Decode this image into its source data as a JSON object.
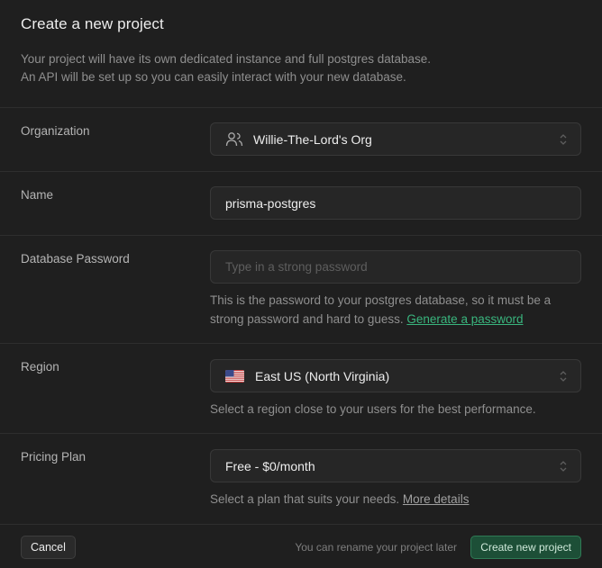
{
  "dialog": {
    "title": "Create a new project",
    "description_line1": "Your project will have its own dedicated instance and full postgres database.",
    "description_line2": "An API will be set up so you can easily interact with your new database."
  },
  "organization": {
    "label": "Organization",
    "value": "Willie-The-Lord's Org",
    "icon": "users-icon"
  },
  "name": {
    "label": "Name",
    "value": "prisma-postgres"
  },
  "password": {
    "label": "Database Password",
    "placeholder": "Type in a strong password",
    "value": "",
    "help_line1": "This is the password to your postgres database, so it must be a",
    "help_line2_prefix": "strong password and hard to guess.",
    "generate_link": "Generate a password"
  },
  "region": {
    "label": "Region",
    "value": "East US (North Virginia)",
    "flag": "us-flag-icon",
    "help": "Select a region close to your users for the best performance."
  },
  "pricing": {
    "label": "Pricing Plan",
    "value": "Free - $0/month",
    "help_prefix": "Select a plan that suits your needs.",
    "details_link": "More details"
  },
  "footer": {
    "cancel_label": "Cancel",
    "note": "You can rename your project later",
    "create_label": "Create new project"
  },
  "colors": {
    "background": "#1f1f1f",
    "accent": "#3ecf8e",
    "create_button_bg": "#1d4f37"
  }
}
